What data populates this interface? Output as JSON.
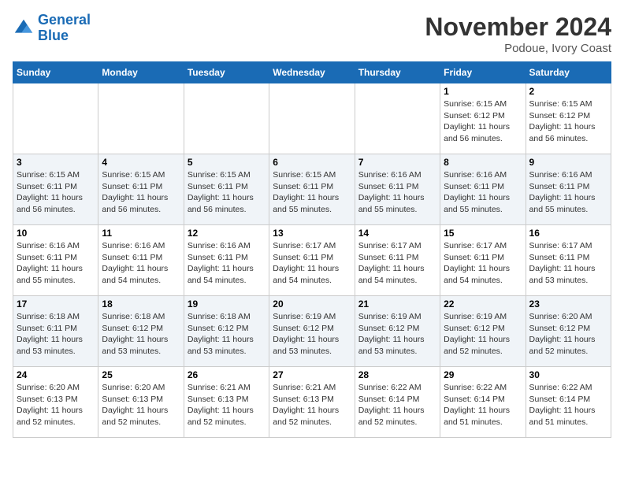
{
  "header": {
    "logo_line1": "General",
    "logo_line2": "Blue",
    "title": "November 2024",
    "subtitle": "Podoue, Ivory Coast"
  },
  "days_of_week": [
    "Sunday",
    "Monday",
    "Tuesday",
    "Wednesday",
    "Thursday",
    "Friday",
    "Saturday"
  ],
  "weeks": [
    [
      {
        "day": "",
        "info": ""
      },
      {
        "day": "",
        "info": ""
      },
      {
        "day": "",
        "info": ""
      },
      {
        "day": "",
        "info": ""
      },
      {
        "day": "",
        "info": ""
      },
      {
        "day": "1",
        "info": "Sunrise: 6:15 AM\nSunset: 6:12 PM\nDaylight: 11 hours and 56 minutes."
      },
      {
        "day": "2",
        "info": "Sunrise: 6:15 AM\nSunset: 6:12 PM\nDaylight: 11 hours and 56 minutes."
      }
    ],
    [
      {
        "day": "3",
        "info": "Sunrise: 6:15 AM\nSunset: 6:11 PM\nDaylight: 11 hours and 56 minutes."
      },
      {
        "day": "4",
        "info": "Sunrise: 6:15 AM\nSunset: 6:11 PM\nDaylight: 11 hours and 56 minutes."
      },
      {
        "day": "5",
        "info": "Sunrise: 6:15 AM\nSunset: 6:11 PM\nDaylight: 11 hours and 56 minutes."
      },
      {
        "day": "6",
        "info": "Sunrise: 6:15 AM\nSunset: 6:11 PM\nDaylight: 11 hours and 55 minutes."
      },
      {
        "day": "7",
        "info": "Sunrise: 6:16 AM\nSunset: 6:11 PM\nDaylight: 11 hours and 55 minutes."
      },
      {
        "day": "8",
        "info": "Sunrise: 6:16 AM\nSunset: 6:11 PM\nDaylight: 11 hours and 55 minutes."
      },
      {
        "day": "9",
        "info": "Sunrise: 6:16 AM\nSunset: 6:11 PM\nDaylight: 11 hours and 55 minutes."
      }
    ],
    [
      {
        "day": "10",
        "info": "Sunrise: 6:16 AM\nSunset: 6:11 PM\nDaylight: 11 hours and 55 minutes."
      },
      {
        "day": "11",
        "info": "Sunrise: 6:16 AM\nSunset: 6:11 PM\nDaylight: 11 hours and 54 minutes."
      },
      {
        "day": "12",
        "info": "Sunrise: 6:16 AM\nSunset: 6:11 PM\nDaylight: 11 hours and 54 minutes."
      },
      {
        "day": "13",
        "info": "Sunrise: 6:17 AM\nSunset: 6:11 PM\nDaylight: 11 hours and 54 minutes."
      },
      {
        "day": "14",
        "info": "Sunrise: 6:17 AM\nSunset: 6:11 PM\nDaylight: 11 hours and 54 minutes."
      },
      {
        "day": "15",
        "info": "Sunrise: 6:17 AM\nSunset: 6:11 PM\nDaylight: 11 hours and 54 minutes."
      },
      {
        "day": "16",
        "info": "Sunrise: 6:17 AM\nSunset: 6:11 PM\nDaylight: 11 hours and 53 minutes."
      }
    ],
    [
      {
        "day": "17",
        "info": "Sunrise: 6:18 AM\nSunset: 6:11 PM\nDaylight: 11 hours and 53 minutes."
      },
      {
        "day": "18",
        "info": "Sunrise: 6:18 AM\nSunset: 6:12 PM\nDaylight: 11 hours and 53 minutes."
      },
      {
        "day": "19",
        "info": "Sunrise: 6:18 AM\nSunset: 6:12 PM\nDaylight: 11 hours and 53 minutes."
      },
      {
        "day": "20",
        "info": "Sunrise: 6:19 AM\nSunset: 6:12 PM\nDaylight: 11 hours and 53 minutes."
      },
      {
        "day": "21",
        "info": "Sunrise: 6:19 AM\nSunset: 6:12 PM\nDaylight: 11 hours and 53 minutes."
      },
      {
        "day": "22",
        "info": "Sunrise: 6:19 AM\nSunset: 6:12 PM\nDaylight: 11 hours and 52 minutes."
      },
      {
        "day": "23",
        "info": "Sunrise: 6:20 AM\nSunset: 6:12 PM\nDaylight: 11 hours and 52 minutes."
      }
    ],
    [
      {
        "day": "24",
        "info": "Sunrise: 6:20 AM\nSunset: 6:13 PM\nDaylight: 11 hours and 52 minutes."
      },
      {
        "day": "25",
        "info": "Sunrise: 6:20 AM\nSunset: 6:13 PM\nDaylight: 11 hours and 52 minutes."
      },
      {
        "day": "26",
        "info": "Sunrise: 6:21 AM\nSunset: 6:13 PM\nDaylight: 11 hours and 52 minutes."
      },
      {
        "day": "27",
        "info": "Sunrise: 6:21 AM\nSunset: 6:13 PM\nDaylight: 11 hours and 52 minutes."
      },
      {
        "day": "28",
        "info": "Sunrise: 6:22 AM\nSunset: 6:14 PM\nDaylight: 11 hours and 52 minutes."
      },
      {
        "day": "29",
        "info": "Sunrise: 6:22 AM\nSunset: 6:14 PM\nDaylight: 11 hours and 51 minutes."
      },
      {
        "day": "30",
        "info": "Sunrise: 6:22 AM\nSunset: 6:14 PM\nDaylight: 11 hours and 51 minutes."
      }
    ]
  ]
}
